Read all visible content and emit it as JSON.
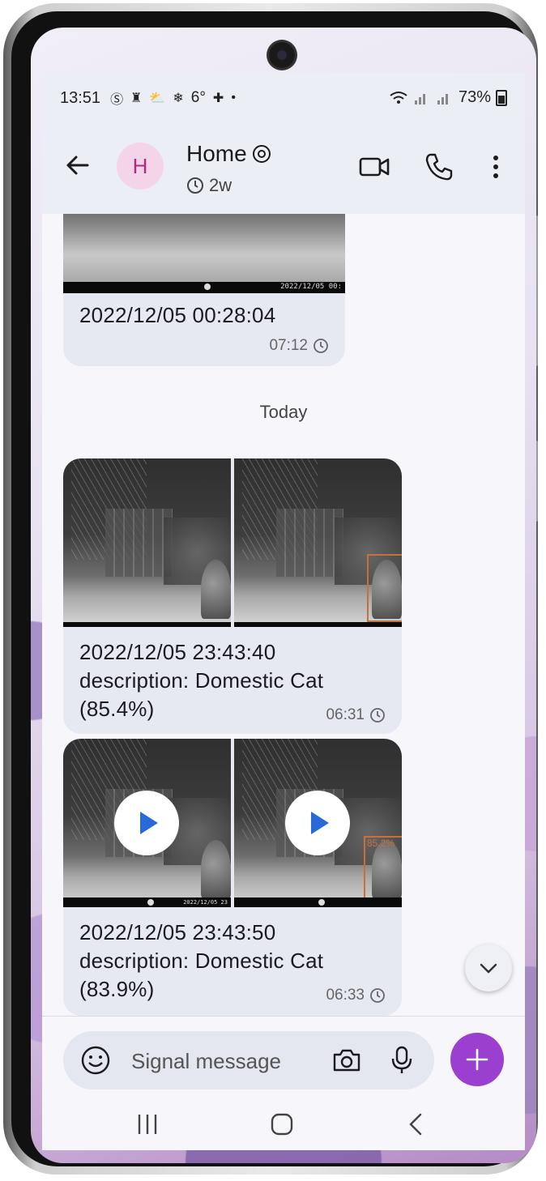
{
  "status_bar": {
    "time": "13:51",
    "battery": "73%"
  },
  "header": {
    "avatar_letter": "H",
    "title": "Home",
    "disappearing_timer": "2w"
  },
  "messages": [
    {
      "text_lines": [
        "2022/12/05 00:28:04"
      ],
      "time": "07:12",
      "images": [
        "night-camera-grass"
      ]
    },
    {
      "day_divider": "Today"
    },
    {
      "text_lines": [
        "2022/12/05 23:43:40",
        "description:  Domestic Cat",
        "(85.4%)"
      ],
      "time": "06:31",
      "images": [
        "night-camera",
        "night-camera-detection"
      ]
    },
    {
      "text_lines": [
        "2022/12/05 23:43:50",
        "description:  Domestic Cat",
        "(83.9%)"
      ],
      "time": "06:33",
      "images": [
        "night-camera-video",
        "night-camera-video-detection"
      ]
    }
  ],
  "overlay_texts": {
    "strip_first": "2022/12/05 00:",
    "strip_small": "2022/12/05 23",
    "detection_label": "85.2%"
  },
  "composer": {
    "placeholder": "Signal message"
  },
  "colors": {
    "accent": "#9b3fd0",
    "bubble": "#e6e8f2",
    "header_bg": "#eceef5",
    "avatar_bg": "#f4d4e9",
    "avatar_fg": "#b22a7d",
    "play_icon": "#2a6ad6"
  }
}
